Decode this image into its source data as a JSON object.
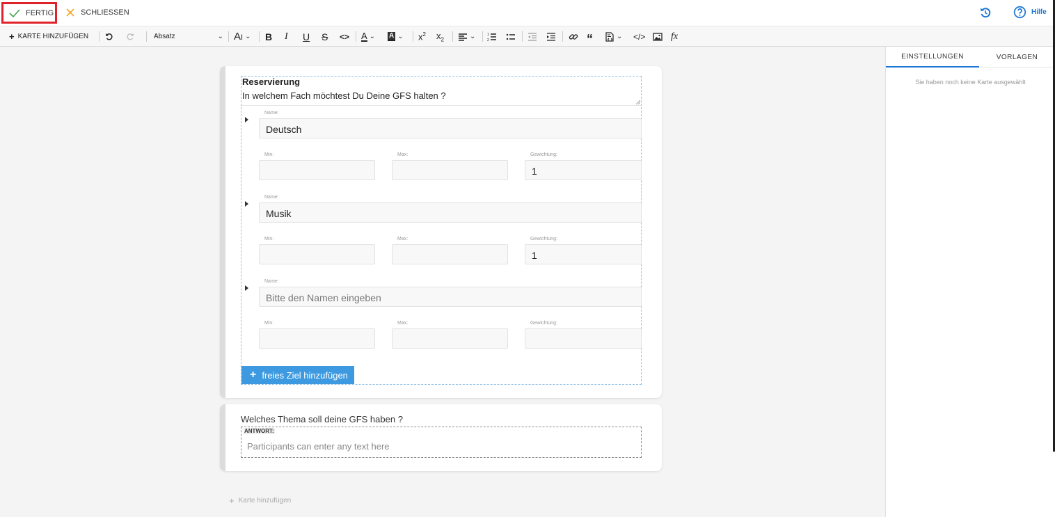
{
  "topbar": {
    "done_label": "FERTIG",
    "close_label": "SCHLIESSEN",
    "help_label": "Hilfe"
  },
  "toolbar": {
    "add_card_label": "KARTE HINZUFÜGEN",
    "paragraph_select": "Absatz",
    "font_size_label": "AΙ"
  },
  "card1": {
    "title": "Reservierung",
    "question": "In welchem Fach möchtest Du Deine GFS halten ?",
    "goals": [
      {
        "name_label": "Name:",
        "name_value": "Deutsch",
        "name_placeholder": "",
        "min_label": "Min:",
        "min_value": "",
        "max_label": "Max:",
        "max_value": "",
        "weight_label": "Gewichtung:",
        "weight_value": "1"
      },
      {
        "name_label": "Name:",
        "name_value": "Musik",
        "name_placeholder": "",
        "min_label": "Min:",
        "min_value": "",
        "max_label": "Max:",
        "max_value": "",
        "weight_label": "Gewichtung:",
        "weight_value": "1"
      },
      {
        "name_label": "Name:",
        "name_value": "",
        "name_placeholder": "Bitte den Namen eingeben",
        "min_label": "Min:",
        "min_value": "",
        "max_label": "Max:",
        "max_value": "",
        "weight_label": "Gewichtung:",
        "weight_value": ""
      }
    ],
    "add_goal_label": "freies Ziel hinzufügen"
  },
  "card2": {
    "question": "Welches Thema soll deine GFS haben ?",
    "answer_label": "ANTWORT:",
    "answer_placeholder": "Participants can enter any text here"
  },
  "add_card_link": "Karte hinzufügen",
  "right_panel": {
    "tabs": [
      "EINSTELLUNGEN",
      "VORLAGEN"
    ],
    "active_tab": "EINSTELLUNGEN",
    "empty_message": "Sie haben noch keine Karte ausgewählt"
  },
  "colors": {
    "accent": "#1976d2",
    "add_goal_bg": "#3d9ae0",
    "done_highlight": "#e0232b",
    "check_green": "#43a047",
    "close_orange": "#f5a623"
  }
}
